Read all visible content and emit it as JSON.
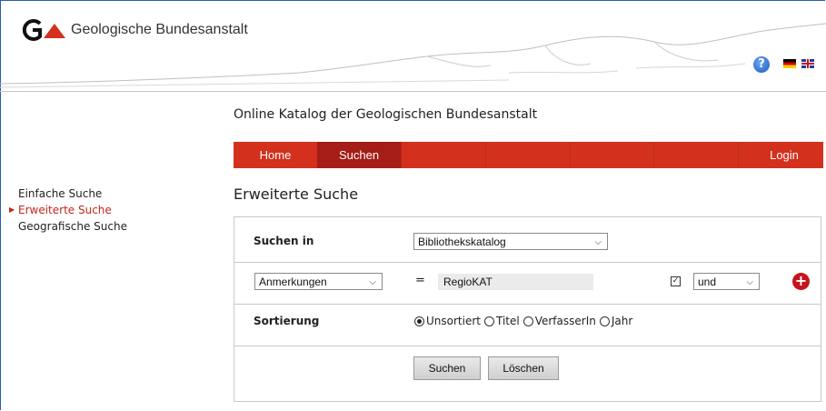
{
  "header": {
    "logo_text": "Geologische Bundesanstalt",
    "help_icon_label": "?"
  },
  "catalog_title": "Online Katalog der Geologischen Bundesanstalt",
  "nav": {
    "items": [
      {
        "label": "Home",
        "active": false
      },
      {
        "label": "Suchen",
        "active": true
      }
    ],
    "login": "Login"
  },
  "sidebar": {
    "items": [
      {
        "label": "Einfache Suche",
        "active": false
      },
      {
        "label": "Erweiterte Suche",
        "active": true
      },
      {
        "label": "Geografische Suche",
        "active": false
      }
    ]
  },
  "page_heading": "Erweiterte Suche",
  "form": {
    "search_in_label": "Suchen in",
    "search_in_value": "Bibliothekskatalog",
    "field_value": "Anmerkungen",
    "operator": "=",
    "search_text": "RegioKAT",
    "checkbox_checked": true,
    "bool_value": "und",
    "sort_label": "Sortierung",
    "sort_options": [
      "Unsortiert",
      "Titel",
      "VerfasserIn",
      "Jahr"
    ],
    "sort_selected": "Unsortiert",
    "search_button": "Suchen",
    "clear_button": "Löschen"
  },
  "colors": {
    "nav_red": "#d3301e",
    "nav_active": "#a51d16",
    "accent_text": "#c0281a",
    "add_button": "#c4151c"
  }
}
